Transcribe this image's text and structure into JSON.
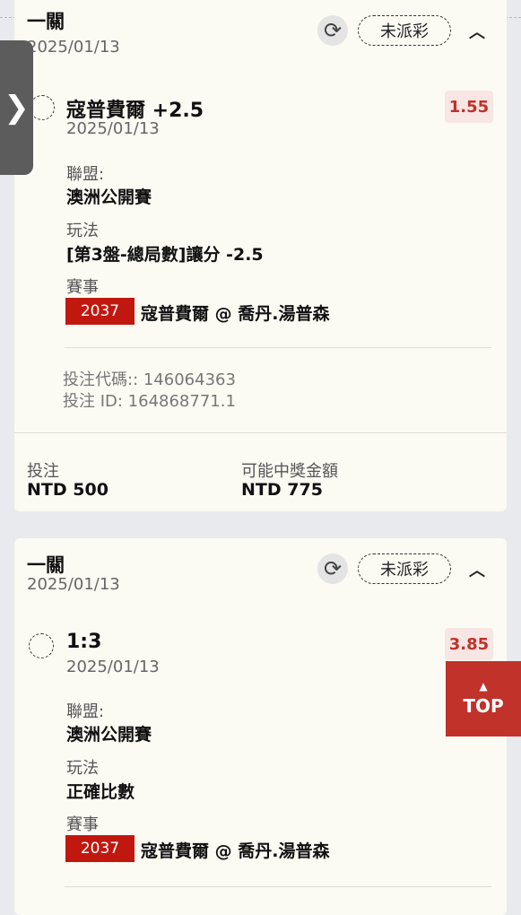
{
  "colors": {
    "accent": "#c0322a",
    "event_badge": "#c0180f",
    "odds_bg": "#f7e6e3",
    "card_bg": "#fbfaf3",
    "page_bg": "#e9eaed"
  },
  "icons": {
    "refresh": "refresh-icon",
    "caret": "chevron-up-icon",
    "side_tab": "chevron-right-icon",
    "top": "arrow-up-icon"
  },
  "side_tab": {
    "glyph": "❯"
  },
  "top_button": {
    "arrow": "▲",
    "label": "TOP"
  },
  "cards": [
    {
      "bet_type": "一關",
      "date": "2025/01/13",
      "status": "未派彩",
      "selection": {
        "name": "寇普費爾 +2.5",
        "date": "2025/01/13",
        "odds": "1.55"
      },
      "league_label": "聯盟:",
      "league": "澳洲公開賽",
      "market_label": "玩法",
      "market": "[第3盤-總局數]讓分 -2.5",
      "event_label": "賽事",
      "event_id": "2037",
      "event_name": "寇普費爾 @ 喬丹.湯普森",
      "bet_code": "投注代碼:: 146064363",
      "bet_id": "投注 ID: 164868771.1",
      "stake_label": "投注",
      "stake": "NTD 500",
      "payout_label": "可能中獎金額",
      "payout": "NTD 775"
    },
    {
      "bet_type": "一關",
      "date": "2025/01/13",
      "status": "未派彩",
      "selection": {
        "name": "1:3",
        "date": "2025/01/13",
        "odds": "3.85"
      },
      "league_label": "聯盟:",
      "league": "澳洲公開賽",
      "market_label": "玩法",
      "market": "正確比數",
      "event_label": "賽事",
      "event_id": "2037",
      "event_name": "寇普費爾 @ 喬丹.湯普森"
    }
  ]
}
